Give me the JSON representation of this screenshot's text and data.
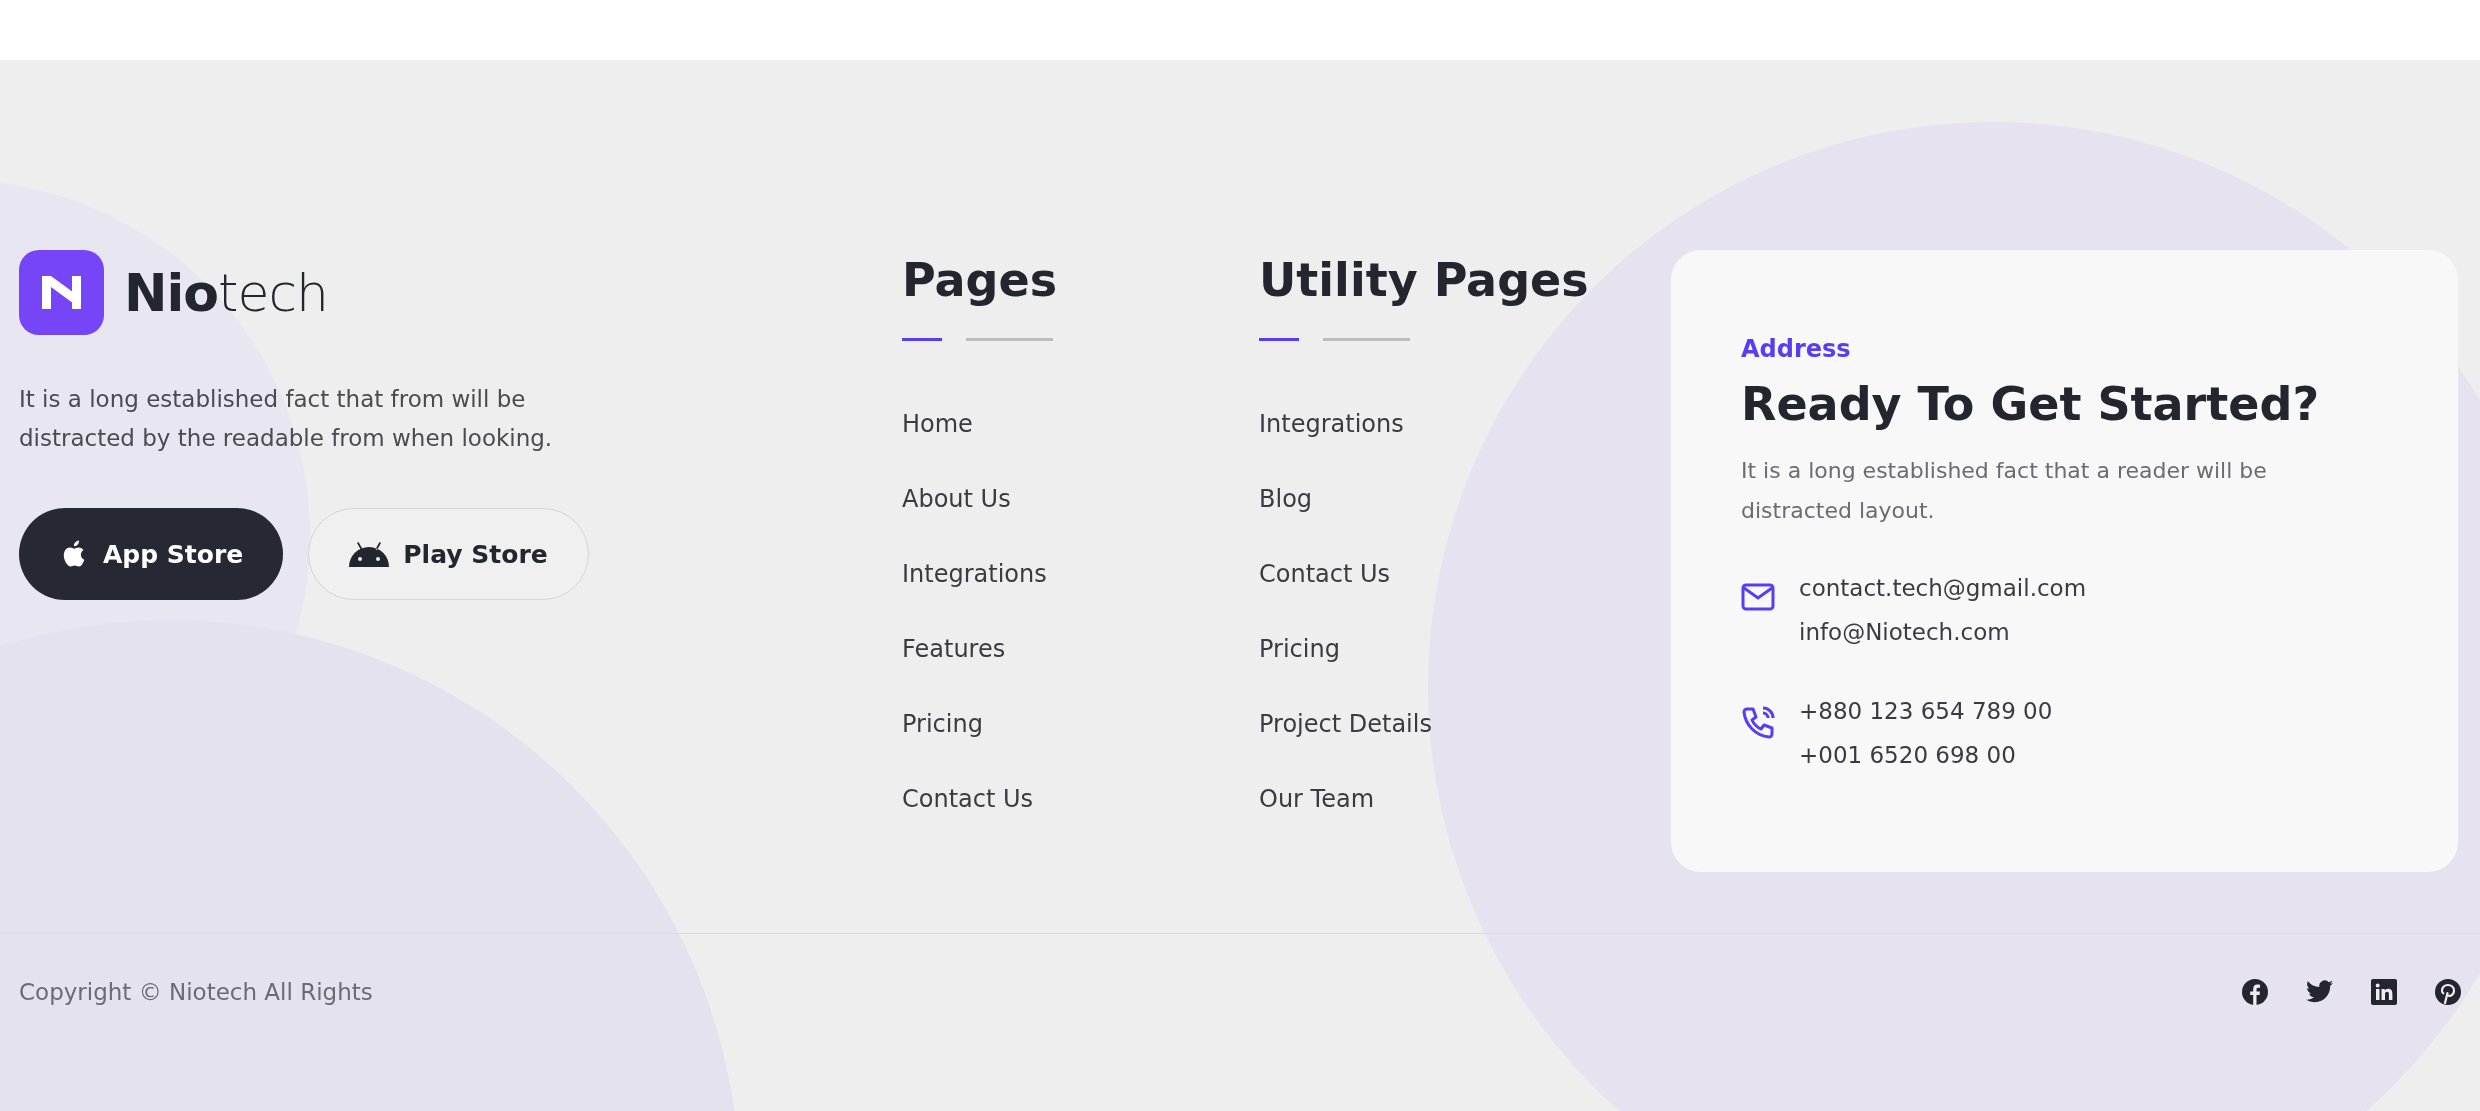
{
  "brand": {
    "name_bold": "Nio",
    "name_light": "tech",
    "description": "It is a long established fact that from will be distracted by the readable from when looking."
  },
  "store_buttons": [
    {
      "kind": "apple",
      "label": "App Store"
    },
    {
      "kind": "android",
      "label": "Play Store"
    }
  ],
  "link_columns": [
    {
      "title": "Pages",
      "links": [
        "Home",
        "About Us",
        "Integrations",
        "Features",
        "Pricing",
        "Contact Us"
      ]
    },
    {
      "title": "Utility Pages",
      "links": [
        "Integrations",
        "Blog",
        "Contact Us",
        "Pricing",
        "Project Details",
        "Our Team"
      ]
    }
  ],
  "contact_card": {
    "eyebrow": "Address",
    "title": "Ready To Get Started?",
    "description": "It is a long established fact that a reader will be distracted layout.",
    "groups": [
      {
        "kind": "email",
        "lines": [
          "contact.tech@gmail.com",
          "info@Niotech.com"
        ]
      },
      {
        "kind": "phone",
        "lines": [
          "+880 123 654 789 00",
          "+001 6520 698 00"
        ]
      }
    ]
  },
  "footer_bar": {
    "copyright": "Copyright © Niotech All Rights",
    "social": [
      {
        "kind": "facebook"
      },
      {
        "kind": "twitter"
      },
      {
        "kind": "linkedin"
      },
      {
        "kind": "pinterest"
      }
    ]
  }
}
